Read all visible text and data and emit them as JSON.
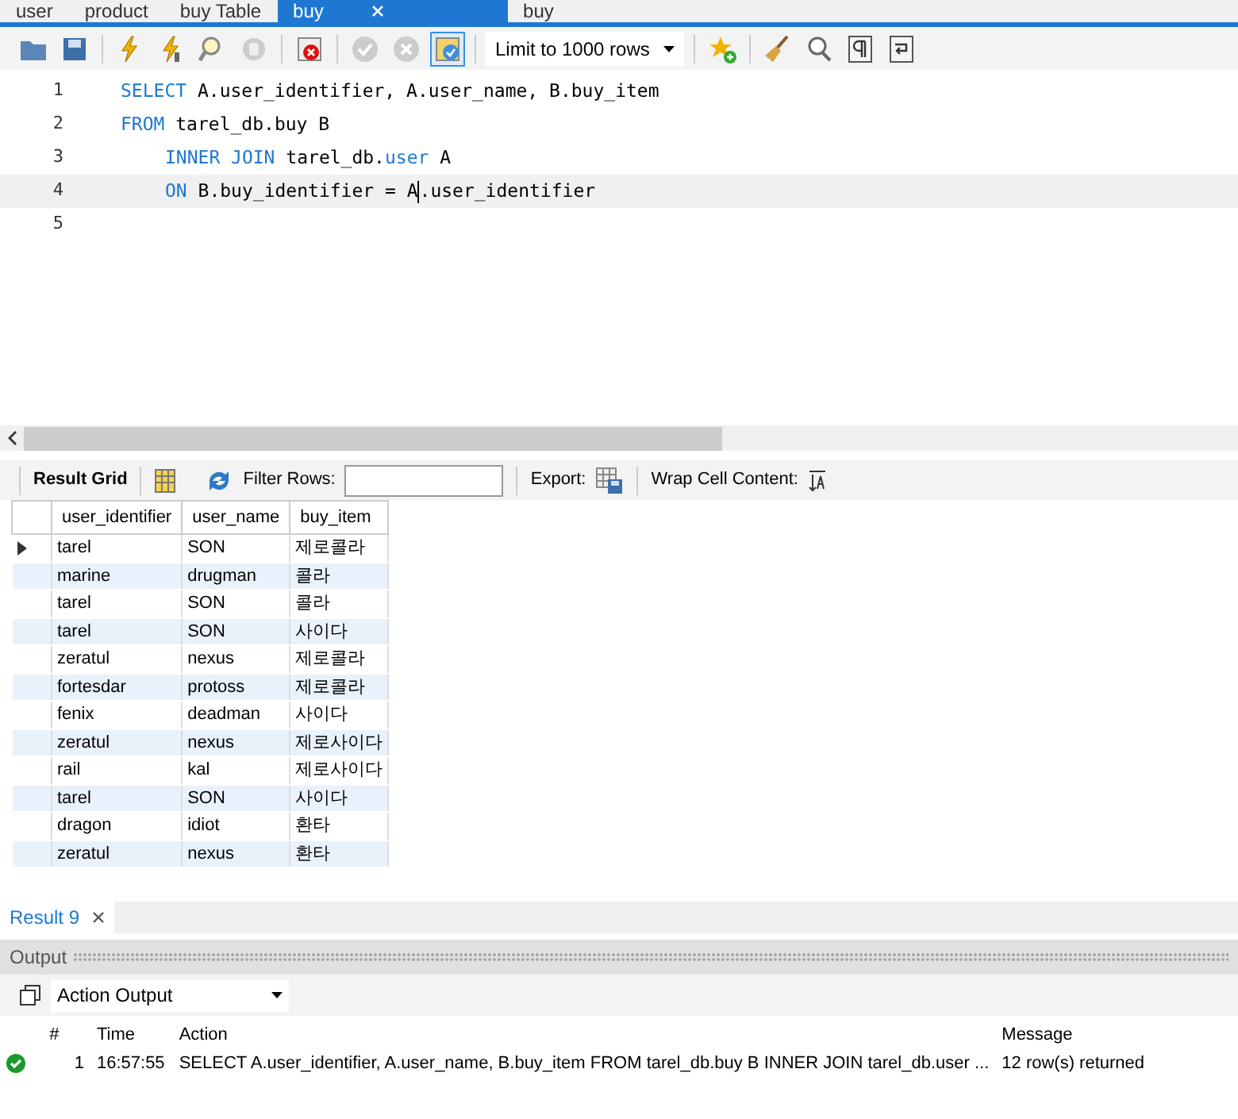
{
  "tabs": [
    {
      "label": "user",
      "selected": false
    },
    {
      "label": "product",
      "selected": false
    },
    {
      "label": "buy Table",
      "selected": false
    },
    {
      "label": "buy",
      "selected": true,
      "closable": true
    },
    {
      "label": "buy",
      "selected": false
    }
  ],
  "toolbar": {
    "limit": "Limit to 1000 rows",
    "toggle_on": true
  },
  "editor": {
    "lines": [
      {
        "number": "1",
        "current": false,
        "tokens": [
          {
            "kind": "keyword",
            "text": "SELECT"
          },
          {
            "kind": "plain",
            "text": " A.user_identifier, A.user_name, B.buy_item"
          }
        ]
      },
      {
        "number": "2",
        "current": false,
        "tokens": [
          {
            "kind": "keyword",
            "text": "FROM"
          },
          {
            "kind": "plain",
            "text": " tarel_db.buy B"
          }
        ]
      },
      {
        "number": "3",
        "current": false,
        "indented": true,
        "tokens": [
          {
            "kind": "keyword",
            "text": "INNER JOIN"
          },
          {
            "kind": "plain",
            "text": " tarel_db."
          },
          {
            "kind": "keyword",
            "text": "user"
          },
          {
            "kind": "plain",
            "text": " A"
          }
        ]
      },
      {
        "number": "4",
        "current": true,
        "indented": true,
        "tokens": [
          {
            "kind": "keyword",
            "text": "ON"
          },
          {
            "kind": "plain",
            "text": " B.buy_identifier = A.user_identifier"
          }
        ]
      },
      {
        "number": "5",
        "current": false
      }
    ]
  },
  "result_toolbar": {
    "result_grid": "Result Grid",
    "filter_label": "Filter Rows:",
    "export_label": "Export:",
    "wrap_label": "Wrap Cell Content:"
  },
  "grid": {
    "columns": [
      "user_identifier",
      "user_name",
      "buy_item"
    ],
    "rows": [
      {
        "cells": [
          "tarel",
          "SON",
          "제로콜라"
        ],
        "current": true
      },
      {
        "cells": [
          "marine",
          "drugman",
          "콜라"
        ],
        "current": false
      },
      {
        "cells": [
          "tarel",
          "SON",
          "콜라"
        ],
        "current": false
      },
      {
        "cells": [
          "tarel",
          "SON",
          "사이다"
        ],
        "current": false
      },
      {
        "cells": [
          "zeratul",
          "nexus",
          "제로콜라"
        ],
        "current": false
      },
      {
        "cells": [
          "fortesdar",
          "protoss",
          "제로콜라"
        ],
        "current": false
      },
      {
        "cells": [
          "fenix",
          "deadman",
          "사이다"
        ],
        "current": false
      },
      {
        "cells": [
          "zeratul",
          "nexus",
          "제로사이다"
        ],
        "current": false
      },
      {
        "cells": [
          "rail",
          "kal",
          "제로사이다"
        ],
        "current": false
      },
      {
        "cells": [
          "tarel",
          "SON",
          "사이다"
        ],
        "current": false
      },
      {
        "cells": [
          "dragon",
          "idiot",
          "환타"
        ],
        "current": false
      },
      {
        "cells": [
          "zeratul",
          "nexus",
          "환타"
        ],
        "current": false
      }
    ]
  },
  "result_tab": {
    "label": "Result 9"
  },
  "output": {
    "title": "Output",
    "selector": "Action Output",
    "columns": [
      "#",
      "Time",
      "Action",
      "Message"
    ],
    "rows": [
      {
        "success": true,
        "number": "1",
        "time": "16:57:55",
        "action": "SELECT A.user_identifier, A.user_name, B.buy_item FROM tarel_db.buy B INNER JOIN tarel_db.user ...",
        "message": "12 row(s) returned"
      }
    ]
  }
}
